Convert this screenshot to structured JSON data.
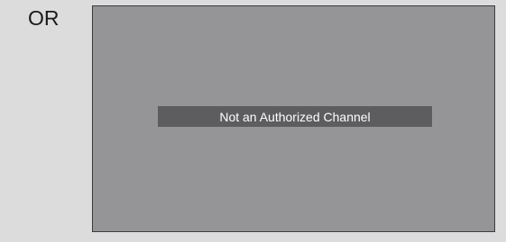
{
  "label": {
    "text": "OR"
  },
  "screen": {
    "message": "Not an Authorized Channel"
  },
  "colors": {
    "panel_background": "#dcdcdd",
    "screen_background": "#959597",
    "screen_border": "#3c3c3e",
    "banner_background": "#5d5d5f",
    "banner_text": "#ffffff",
    "label_text": "#1a1a1a"
  }
}
